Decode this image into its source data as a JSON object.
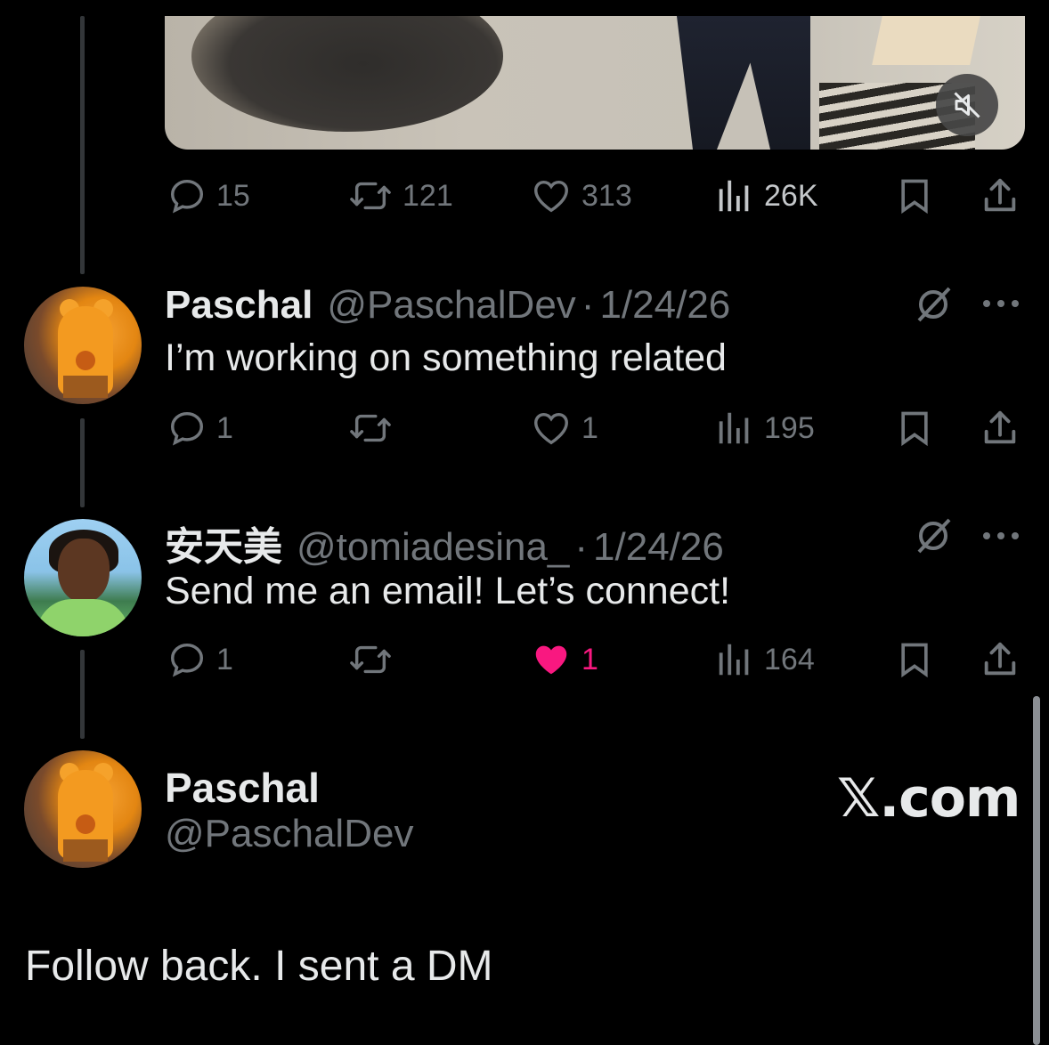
{
  "top_post": {
    "video_muted_icon": "speaker-muted-icon",
    "actions": {
      "replies": "15",
      "reposts": "121",
      "likes": "313",
      "views": "26K"
    }
  },
  "replies": [
    {
      "name": "Paschal",
      "handle": "@PaschalDev",
      "separator": "·",
      "date": "1/24/26",
      "text": "I’m working on something related",
      "actions": {
        "replies": "1",
        "reposts": "",
        "likes": "1",
        "views": "195"
      },
      "liked": false
    },
    {
      "name": "安天美",
      "handle": "@tomiadesina_",
      "separator": "·",
      "date": "1/24/26",
      "text": "Send me an email! Let’s connect!",
      "actions": {
        "replies": "1",
        "reposts": "",
        "likes": "1",
        "views": "164"
      },
      "liked": true
    }
  ],
  "composer": {
    "name": "Paschal",
    "handle": "@PaschalDev",
    "brand": "𝕏.com",
    "text": "Follow back. I sent a DM"
  },
  "colors": {
    "background": "#000000",
    "muted_text": "#71767b",
    "primary_text": "#e7e9ea",
    "like_active": "#f91880",
    "thread_line": "#333639"
  }
}
